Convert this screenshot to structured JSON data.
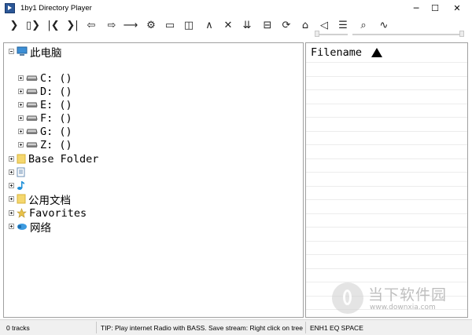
{
  "window": {
    "title": "1by1 Directory Player",
    "controls": {
      "minimize": "─",
      "maximize": "☐",
      "close": "✕"
    }
  },
  "toolbar": {
    "buttons": [
      {
        "name": "play-icon",
        "glyph": "❯"
      },
      {
        "name": "play-pause-icon",
        "glyph": "▯❯"
      },
      {
        "name": "previous-track-icon",
        "glyph": "|❮"
      },
      {
        "name": "next-track-icon",
        "glyph": "❯|"
      },
      {
        "name": "previous-folder-icon",
        "glyph": "⇦"
      },
      {
        "name": "next-folder-icon",
        "glyph": "⇨"
      },
      {
        "name": "jump-arrow-icon",
        "glyph": "⟶"
      },
      {
        "name": "settings-gear-icon",
        "glyph": "⚙"
      },
      {
        "name": "window-icon",
        "glyph": "▭"
      },
      {
        "name": "panel-layout-icon",
        "glyph": "◫"
      },
      {
        "name": "up-icon",
        "glyph": "∧"
      },
      {
        "name": "cancel-icon",
        "glyph": "✕"
      },
      {
        "name": "sort-down-icon",
        "glyph": "⇊"
      },
      {
        "name": "split-view-icon",
        "glyph": "⊟"
      },
      {
        "name": "repeat-icon",
        "glyph": "⟳"
      },
      {
        "name": "home-icon",
        "glyph": "⌂"
      },
      {
        "name": "volume-icon",
        "glyph": "◁"
      },
      {
        "name": "playlist-icon",
        "glyph": "☰"
      },
      {
        "name": "search-icon",
        "glyph": "⌕"
      },
      {
        "name": "waveform-icon",
        "glyph": "∿"
      }
    ]
  },
  "tree": {
    "items": [
      {
        "label": "此电脑",
        "icon": "computer-icon",
        "expander": "minus",
        "level": 0
      },
      {
        "label": "C: ()",
        "icon": "drive-icon",
        "expander": "plus",
        "level": 1
      },
      {
        "label": "D: ()",
        "icon": "drive-icon",
        "expander": "plus",
        "level": 1
      },
      {
        "label": "E: ()",
        "icon": "drive-icon",
        "expander": "plus",
        "level": 1
      },
      {
        "label": "F: ()",
        "icon": "drive-icon",
        "expander": "plus",
        "level": 1
      },
      {
        "label": "G: ()",
        "icon": "drive-icon",
        "expander": "plus",
        "level": 1
      },
      {
        "label": "Z: ()",
        "icon": "drive-icon",
        "expander": "plus",
        "level": 1
      },
      {
        "label": "Base Folder",
        "icon": "folder-icon",
        "expander": "plus",
        "level": 0
      },
      {
        "label": "",
        "icon": "document-icon",
        "expander": "plus",
        "level": 0
      },
      {
        "label": "",
        "icon": "music-note-icon",
        "expander": "plus",
        "level": 0
      },
      {
        "label": "公用文档",
        "icon": "folder-icon",
        "expander": "plus",
        "level": 0
      },
      {
        "label": "Favorites",
        "icon": "star-icon",
        "expander": "plus",
        "level": 0
      },
      {
        "label": "网络",
        "icon": "network-icon",
        "expander": "plus",
        "level": 0
      }
    ]
  },
  "list": {
    "header_label": "Filename"
  },
  "status": {
    "tracks": "0 tracks",
    "tip": "TIP: Play internet Radio with BASS. Save stream: Right click on tree",
    "modes": "ENH1  EQ  SPACE"
  },
  "watermark": {
    "text": "当下软件园",
    "url": "www.downxia.com"
  },
  "colors": {
    "folder": "#f5d76e",
    "computer": "#3c8fd6",
    "music_note": "#1e8fd8",
    "star": "#e8c24a",
    "network": "#3d9be0"
  }
}
